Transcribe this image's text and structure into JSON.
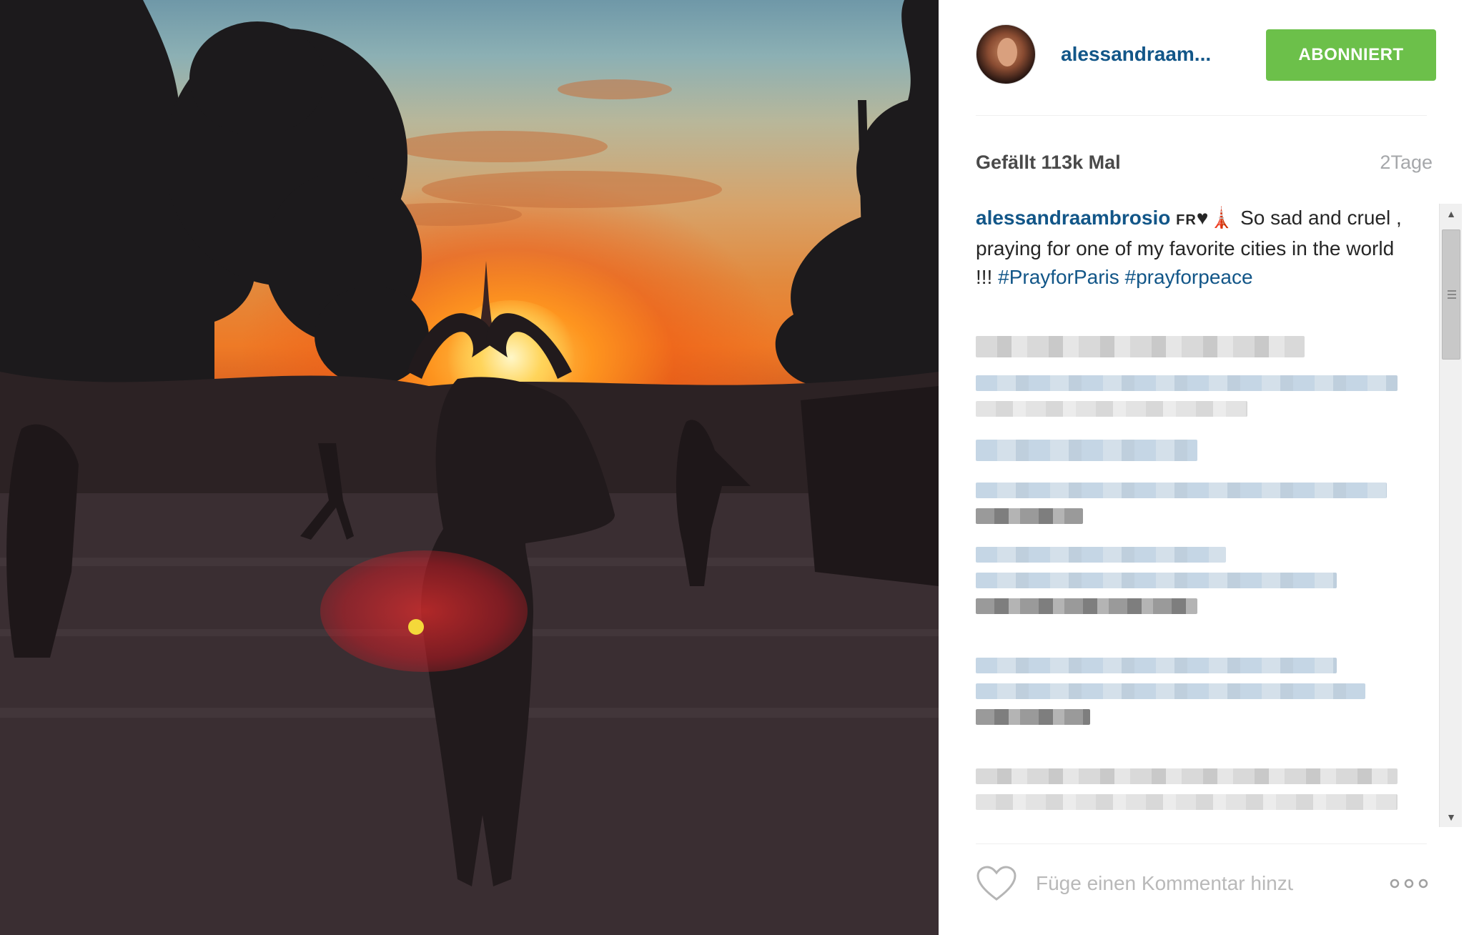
{
  "post": {
    "username_short": "alessandraam...",
    "follow_label": "ABONNIERT",
    "likes_text": "Gefällt 113k Mal",
    "time_text": "2Tage",
    "caption": {
      "username": "alessandraambrosio",
      "flag": "FR",
      "text": " So sad and cruel , praying for one of my favorite cities in the world !!! ",
      "hashtag1": "#PrayforParis",
      "hashtag2": "#prayforpeace"
    },
    "comment_placeholder": "Füge einen Kommentar hinzu ..."
  },
  "icons": {
    "like": "heart-outline-icon",
    "more": "more-options-icon",
    "broken_heart": "broken-heart-emoji",
    "eiffel": "eiffel-tower-emoji"
  },
  "colors": {
    "follow_button": "#6cc04a",
    "username": "#125688",
    "muted": "#a5a7aa"
  }
}
